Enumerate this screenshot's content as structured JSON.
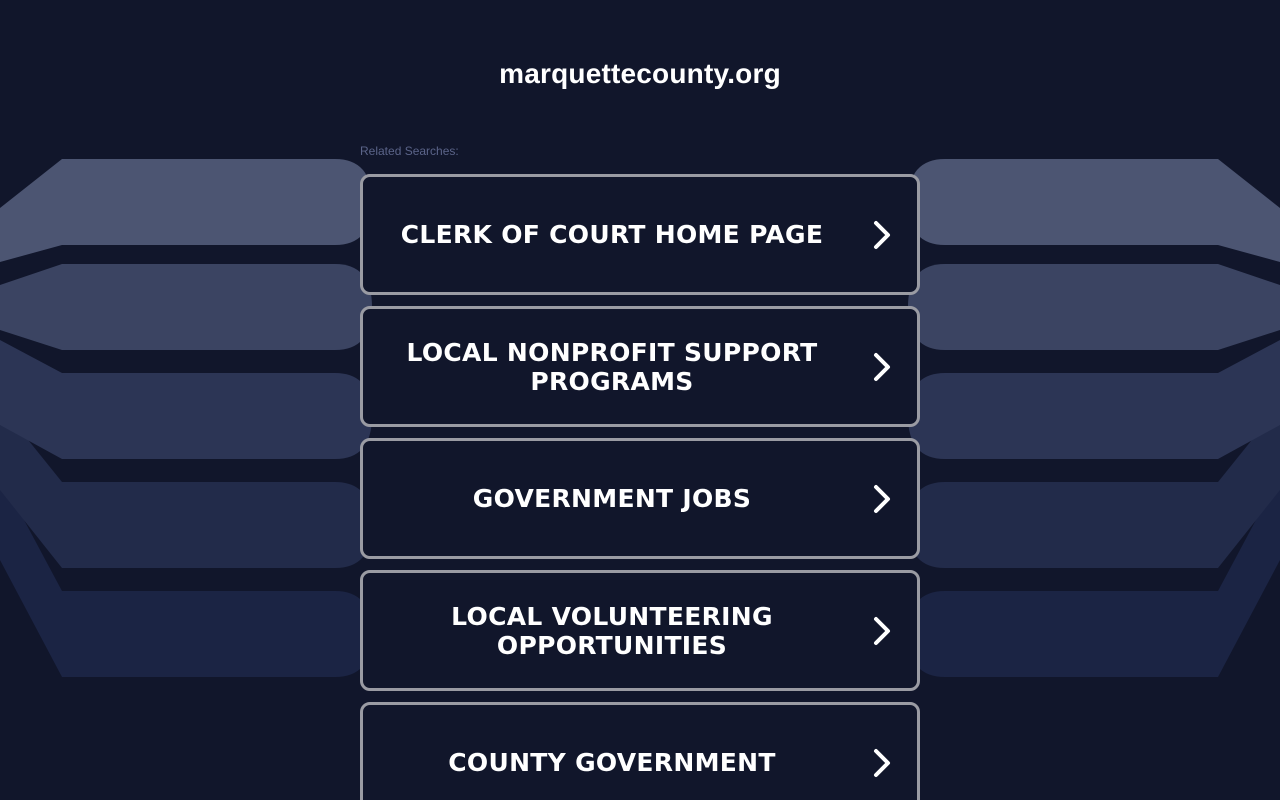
{
  "site": {
    "title": "marquettecounty.org"
  },
  "related_searches": {
    "label": "Related Searches:",
    "items": [
      {
        "label": "CLERK OF COURT HOME PAGE",
        "icon": "chevron-right-icon"
      },
      {
        "label": "LOCAL NONPROFIT SUPPORT PROGRAMS",
        "icon": "chevron-right-icon"
      },
      {
        "label": "GOVERNMENT JOBS",
        "icon": "chevron-right-icon"
      },
      {
        "label": "LOCAL VOLUNTEERING OPPORTUNITIES",
        "icon": "chevron-right-icon"
      },
      {
        "label": "COUNTY GOVERNMENT",
        "icon": "chevron-right-icon"
      }
    ]
  },
  "colors": {
    "background": "#11162b",
    "button_border": "#9a9ba3",
    "text": "#ffffff",
    "label": "#5b6489",
    "shape_1": "#4c5572",
    "shape_2": "#3b4462",
    "shape_3": "#2c3555",
    "shape_4": "#222b4a",
    "shape_5": "#1b2444"
  }
}
